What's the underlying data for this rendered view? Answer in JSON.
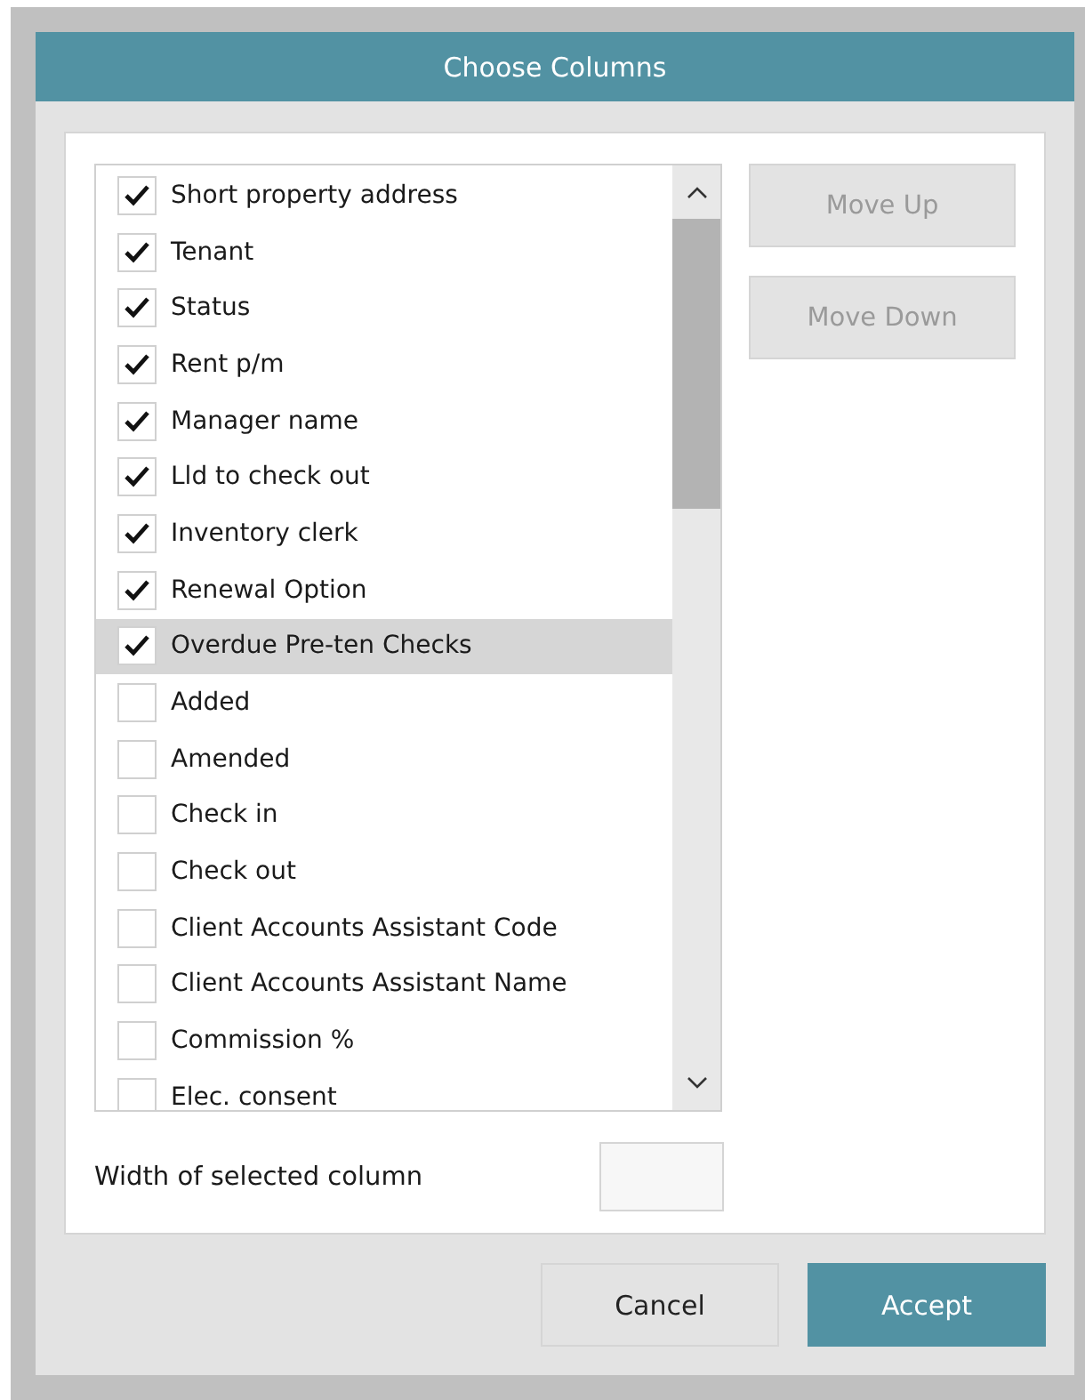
{
  "window": {
    "title": "Choose Columns"
  },
  "columns": [
    {
      "label": "Short property address",
      "checked": true,
      "selected": false
    },
    {
      "label": "Tenant",
      "checked": true,
      "selected": false
    },
    {
      "label": "Status",
      "checked": true,
      "selected": false
    },
    {
      "label": "Rent p/m",
      "checked": true,
      "selected": false
    },
    {
      "label": "Manager name",
      "checked": true,
      "selected": false
    },
    {
      "label": "Lld to check out",
      "checked": true,
      "selected": false
    },
    {
      "label": "Inventory clerk",
      "checked": true,
      "selected": false
    },
    {
      "label": "Renewal Option",
      "checked": true,
      "selected": false
    },
    {
      "label": "Overdue Pre-ten Checks",
      "checked": true,
      "selected": true
    },
    {
      "label": "Added",
      "checked": false,
      "selected": false
    },
    {
      "label": "Amended",
      "checked": false,
      "selected": false
    },
    {
      "label": "Check in",
      "checked": false,
      "selected": false
    },
    {
      "label": "Check out",
      "checked": false,
      "selected": false
    },
    {
      "label": "Client Accounts Assistant Code",
      "checked": false,
      "selected": false
    },
    {
      "label": "Client Accounts Assistant Name",
      "checked": false,
      "selected": false
    },
    {
      "label": "Commission %",
      "checked": false,
      "selected": false
    },
    {
      "label": "Elec. consent",
      "checked": false,
      "selected": false
    }
  ],
  "side_buttons": [
    {
      "label": "Move Up",
      "disabled": true
    },
    {
      "label": "Move Down",
      "disabled": true
    }
  ],
  "width_field": {
    "label": "Width of selected column"
  },
  "buttons": [
    {
      "label": "Cancel",
      "kind": "secondary"
    },
    {
      "label": "Accept",
      "kind": "primary"
    }
  ]
}
